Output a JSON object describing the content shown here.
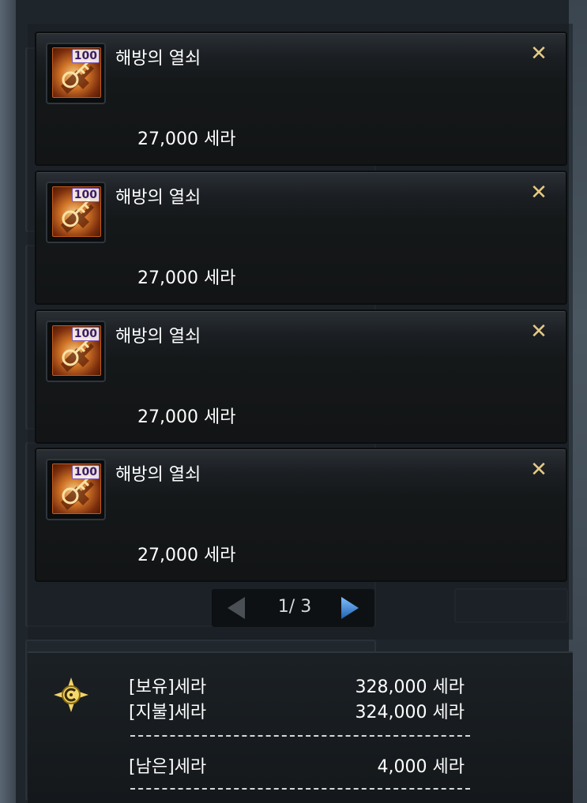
{
  "cart": {
    "items": [
      {
        "name": "해방의 열쇠",
        "level_badge": "100",
        "price": "27,000 세라",
        "close": "✕"
      },
      {
        "name": "해방의 열쇠",
        "level_badge": "100",
        "price": "27,000 세라",
        "close": "✕"
      },
      {
        "name": "해방의 열쇠",
        "level_badge": "100",
        "price": "27,000 세라",
        "close": "✕"
      },
      {
        "name": "해방의 열쇠",
        "level_badge": "100",
        "price": "27,000 세라",
        "close": "✕"
      }
    ],
    "pager": {
      "text": "1/ 3",
      "current_page": 1,
      "total_pages": 3
    }
  },
  "summary": {
    "owned_label": "[보유]세라",
    "owned_value": "328,000 세라",
    "paid_label": "[지불]세라",
    "paid_value": "324,000 세라",
    "remaining_label": "[남은]세라",
    "remaining_value": "4,000 세라"
  },
  "colors": {
    "close_icon": "#e6c983",
    "pager_arrow_active": "#2f7fd0",
    "pager_arrow_inactive": "#4a4f55",
    "text": "#ffffff"
  }
}
